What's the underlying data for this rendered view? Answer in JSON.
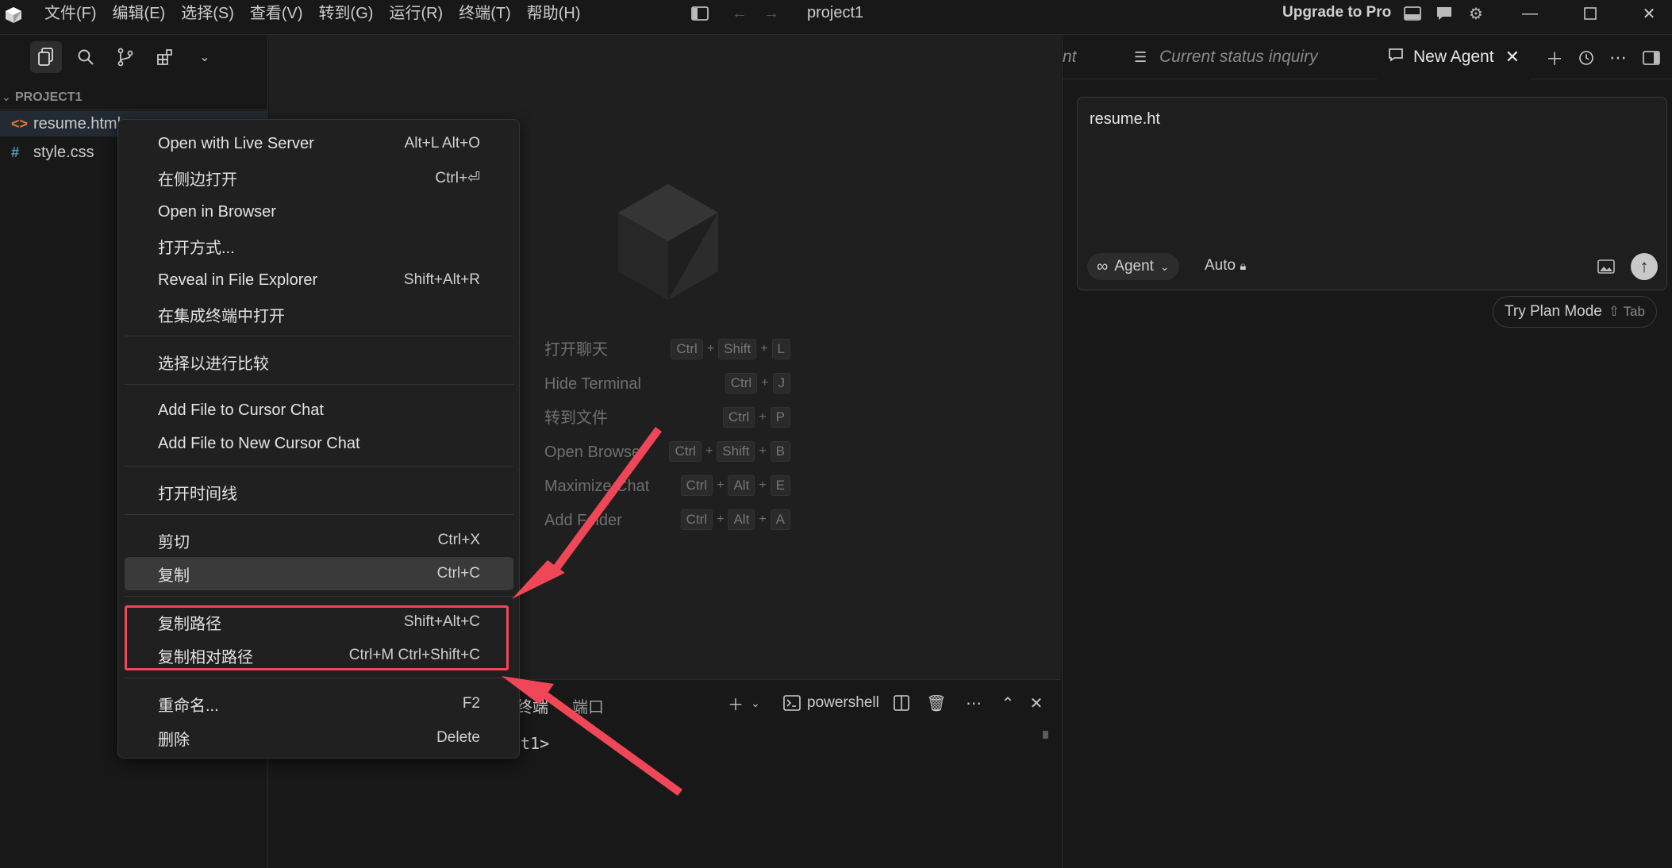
{
  "window": {
    "title": "project1",
    "upgrade_label": "Upgrade to Pro"
  },
  "menu_bar": [
    "文件(F)",
    "编辑(E)",
    "选择(S)",
    "查看(V)",
    "转到(G)",
    "运行(R)",
    "终端(T)",
    "帮助(H)"
  ],
  "explorer": {
    "project_title": "PROJECT1",
    "files": [
      {
        "name": "resume.html",
        "icon": "html-file-icon",
        "icon_glyph": "<>",
        "icon_color": "#e37933"
      },
      {
        "name": "style.css",
        "icon": "css-file-icon",
        "icon_glyph": "#",
        "icon_color": "#519aba"
      }
    ]
  },
  "context_menu": {
    "items": [
      {
        "label": "Open with Live Server",
        "shortcut": "Alt+L Alt+O"
      },
      {
        "label": "在侧边打开",
        "shortcut": "Ctrl+⏎"
      },
      {
        "label": "Open in Browser",
        "shortcut": ""
      },
      {
        "label": "打开方式...",
        "shortcut": ""
      },
      {
        "label": "Reveal in File Explorer",
        "shortcut": "Shift+Alt+R"
      },
      {
        "label": "在集成终端中打开",
        "shortcut": ""
      },
      {
        "label": "选择以进行比较",
        "shortcut": ""
      },
      {
        "label": "Add File to Cursor Chat",
        "shortcut": ""
      },
      {
        "label": "Add File to New Cursor Chat",
        "shortcut": ""
      },
      {
        "label": "打开时间线",
        "shortcut": ""
      },
      {
        "label": "剪切",
        "shortcut": "Ctrl+X"
      },
      {
        "label": "复制",
        "shortcut": "Ctrl+C"
      },
      {
        "label": "复制路径",
        "shortcut": "Shift+Alt+C"
      },
      {
        "label": "复制相对路径",
        "shortcut": "Ctrl+M Ctrl+Shift+C"
      },
      {
        "label": "重命名...",
        "shortcut": "F2"
      },
      {
        "label": "删除",
        "shortcut": "Delete"
      }
    ],
    "highlighted": "复制"
  },
  "welcome_shortcuts": [
    {
      "label": "打开聊天",
      "keys": [
        "Ctrl",
        "Shift",
        "L"
      ]
    },
    {
      "label": "Hide Terminal",
      "keys": [
        "Ctrl",
        "J"
      ]
    },
    {
      "label": "转到文件",
      "keys": [
        "Ctrl",
        "P"
      ]
    },
    {
      "label": "Open Browser",
      "keys": [
        "Ctrl",
        "Shift",
        "B"
      ]
    },
    {
      "label": "Maximize Chat",
      "keys": [
        "Ctrl",
        "Alt",
        "E"
      ]
    },
    {
      "label": "Add Folder",
      "keys": [
        "Ctrl",
        "Alt",
        "A"
      ]
    }
  ],
  "panel": {
    "tabs": [
      "终端",
      "端口"
    ],
    "shell_label": "powershell",
    "prompt": "t1>"
  },
  "agent_panel": {
    "tabs": [
      {
        "label": "nt",
        "active": false
      },
      {
        "label": "Current status inquiry",
        "active": false
      },
      {
        "label": "New Agent",
        "active": true
      }
    ],
    "input_text": "resume.ht",
    "mode_label": "Agent",
    "model_label": "Auto",
    "plan_mode_label": "Try Plan Mode",
    "plan_mode_hint": "⇧ Tab"
  },
  "annotation_color": "#ef4757"
}
